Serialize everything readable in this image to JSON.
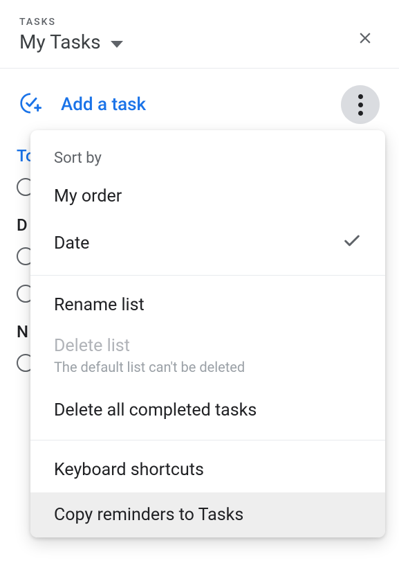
{
  "header": {
    "label": "TASKS",
    "listName": "My Tasks"
  },
  "addTask": {
    "label": "Add a task"
  },
  "sections": {
    "today": "Today",
    "d": "D",
    "n": "N"
  },
  "menu": {
    "sortBy": "Sort by",
    "myOrder": "My order",
    "date": "Date",
    "renameList": "Rename list",
    "deleteList": "Delete list",
    "deleteListSub": "The default list can't be deleted",
    "deleteCompleted": "Delete all completed tasks",
    "keyboardShortcuts": "Keyboard shortcuts",
    "copyReminders": "Copy reminders to Tasks"
  }
}
